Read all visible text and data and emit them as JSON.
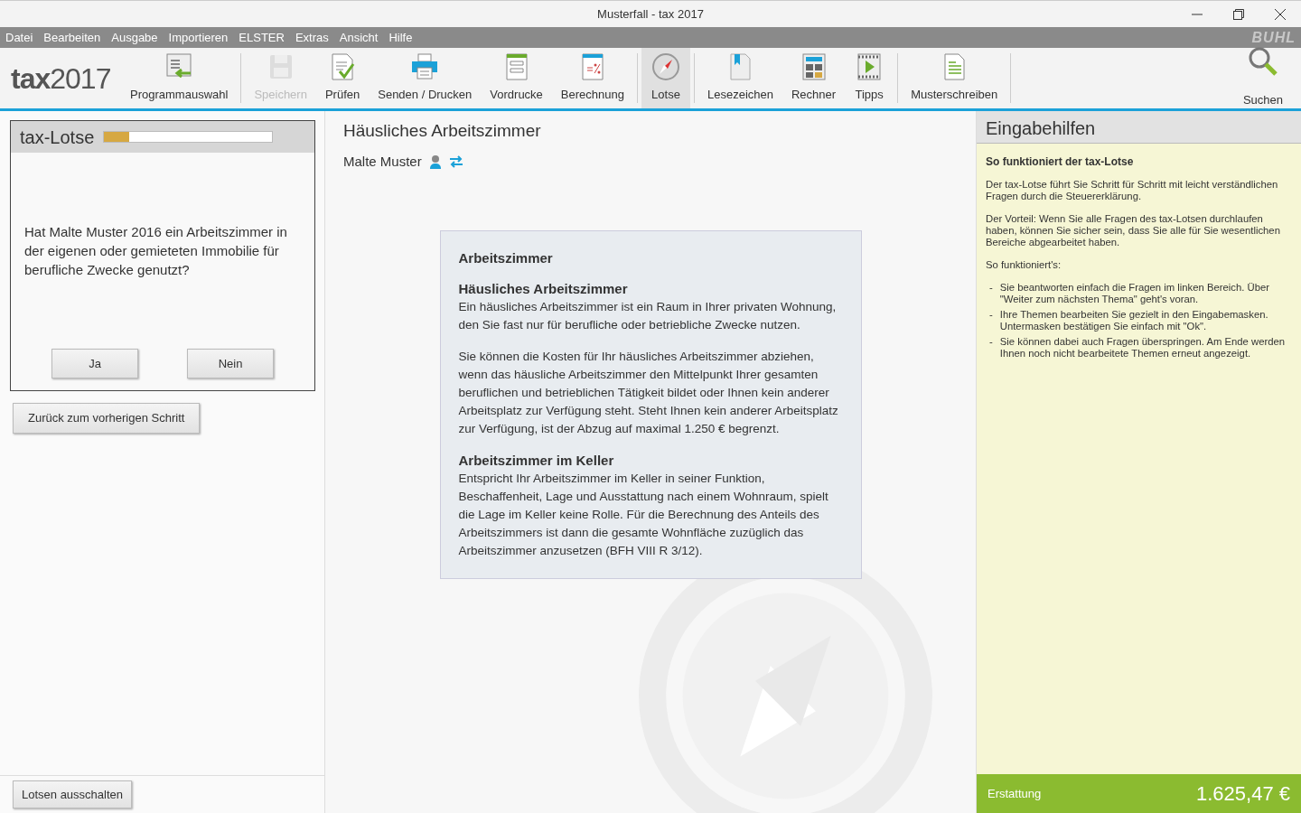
{
  "window": {
    "title": "Musterfall - tax 2017"
  },
  "menu": [
    "Datei",
    "Bearbeiten",
    "Ausgabe",
    "Importieren",
    "ELSTER",
    "Extras",
    "Ansicht",
    "Hilfe"
  ],
  "brand": {
    "logo_word": "tax",
    "logo_year": "2017",
    "vendor": "BUHL"
  },
  "toolbar_groups": [
    [
      {
        "label": "Programmauswahl",
        "disabled": false,
        "selected": false
      }
    ],
    [
      {
        "label": "Speichern",
        "disabled": true,
        "selected": false
      },
      {
        "label": "Prüfen",
        "disabled": false,
        "selected": false
      },
      {
        "label": "Senden / Drucken",
        "disabled": false,
        "selected": false
      },
      {
        "label": "Vordrucke",
        "disabled": false,
        "selected": false
      },
      {
        "label": "Berechnung",
        "disabled": false,
        "selected": false
      }
    ],
    [
      {
        "label": "Lotse",
        "disabled": false,
        "selected": true
      }
    ],
    [
      {
        "label": "Lesezeichen",
        "disabled": false,
        "selected": false
      },
      {
        "label": "Rechner",
        "disabled": false,
        "selected": false
      },
      {
        "label": "Tipps",
        "disabled": false,
        "selected": false
      }
    ],
    [
      {
        "label": "Musterschreiben",
        "disabled": false,
        "selected": false
      }
    ]
  ],
  "search": {
    "label": "Suchen"
  },
  "lotse": {
    "title": "tax-Lotse",
    "level": 0.15,
    "question": "Hat Malte Muster 2016 ein Arbeitszimmer in der eigenen oder gemieteten Immobilie für berufliche Zwecke genutzt?",
    "answers": [
      "Ja",
      "Nein"
    ],
    "back": "Zurück zum vorherigen Schritt",
    "off": "Lotsen ausschalten"
  },
  "main": {
    "title": "Häusliches Arbeitszimmer",
    "person": "Malte Muster",
    "card": {
      "title": "Arbeitszimmer",
      "sections": [
        {
          "heading": "Häusliches Arbeitszimmer",
          "paragraphs": [
            "Ein häusliches Arbeitszimmer ist ein Raum in Ihrer privaten Wohnung, den Sie fast nur für berufliche oder betriebliche Zwecke nutzen.",
            "Sie können die Kosten für Ihr häusliches Arbeitszimmer abziehen, wenn das häusliche Arbeitszimmer den Mittelpunkt Ihrer gesamten beruflichen und betrieblichen Tätigkeit bildet oder Ihnen kein anderer Arbeitsplatz zur Verfügung steht. Steht Ihnen kein anderer Arbeitsplatz zur Verfügung, ist der Abzug auf maximal 1.250 € begrenzt."
          ]
        },
        {
          "heading": "Arbeitszimmer im Keller",
          "paragraphs": [
            "Entspricht Ihr Arbeitszimmer im Keller in seiner Funktion, Beschaffenheit, Lage und Ausstattung nach einem Wohnraum, spielt die Lage im Keller keine Rolle. Für die Berechnung des Anteils des Arbeitszimmers ist dann die gesamte Wohnfläche zuzüglich das Arbeitszimmer anzusetzen (BFH VIII R 3/12)."
          ]
        }
      ]
    }
  },
  "help": {
    "title": "Eingabehilfen",
    "heading": "So funktioniert der tax-Lotse",
    "paragraphs": [
      "Der tax-Lotse führt Sie Schritt für Schritt mit leicht verständlichen Fragen durch die Steuererklärung.",
      "Der Vorteil: Wenn Sie alle Fragen des tax-Lotsen durchlaufen haben, können Sie sicher sein, dass Sie alle für Sie wesentlichen Bereiche abgearbeitet haben.",
      "So funktioniert's:"
    ],
    "bullets": [
      {
        "marker": "-",
        "text": "Sie beantworten einfach die Fragen im linken Bereich. Über \"Weiter zum nächsten Thema\" geht's voran."
      },
      {
        "marker": "-",
        "text": "Ihre Themen bearbeiten Sie gezielt in den Eingabemasken. Untermasken bestätigen Sie einfach mit \"Ok\"."
      },
      {
        "marker": "-",
        "text": "Sie können dabei auch Fragen überspringen. Am Ende werden Ihnen noch nicht bearbeitete Themen erneut angezeigt."
      }
    ]
  },
  "total": {
    "label": "Erstattung",
    "amount": "1.625,47 €"
  }
}
